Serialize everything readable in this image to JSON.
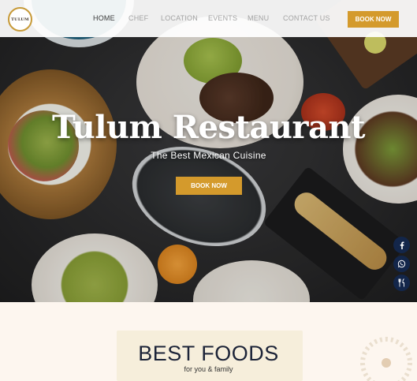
{
  "header": {
    "logo_text": "TULUM",
    "nav": [
      "HOME",
      "CHEF",
      "LOCATION",
      "EVENTS",
      "MENU",
      "CONTACT US"
    ],
    "active_index": 0,
    "book_label": "BOOK NOW"
  },
  "hero": {
    "title": "Tulum Restaurant",
    "subtitle": "The Best Mexican Cuisine",
    "cta_label": "BOOK NOW"
  },
  "social": [
    "facebook-icon",
    "whatsapp-icon",
    "utensils-icon"
  ],
  "foods": {
    "title": "BEST FOODS",
    "subtitle": "for you & family"
  },
  "colors": {
    "accent": "#d49a2c",
    "social_bg": "#13264a",
    "hero_bg": "#2a2a2b",
    "section_bg": "#fdf6ef"
  }
}
